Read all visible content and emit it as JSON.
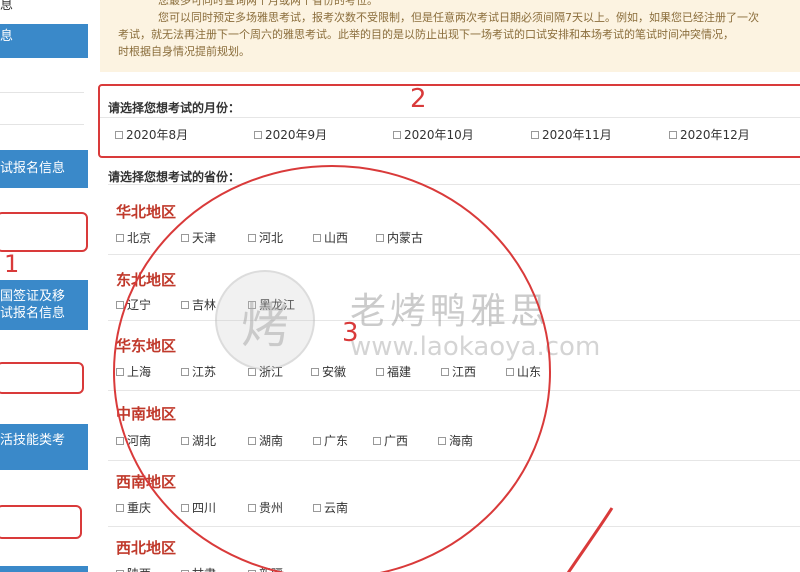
{
  "sidebar": {
    "top_label": "息",
    "item_1": "息",
    "item_2_line1": "试报名信息",
    "item_3_line1": "国签证及移",
    "item_3_line2": "试报名信息",
    "item_4_line1": "活技能类考"
  },
  "notice": {
    "line1": "您最多可同时查询两个月或两个省份的考位。",
    "line2": "您可以同时预定多场雅思考试，报考次数不受限制，但是任意两次考试日期必须间隔7天以上。例如，如果您已经注册了一次",
    "line3": "考试，就无法再注册下一个周六的雅思考试。此举的目的是以防止出现下一场考试的口试安排和本场考试的笔试时间冲突情况，",
    "line4": "时根据自身情况提前规划。"
  },
  "month_section": {
    "title": "请选择您想考试的月份：",
    "options": [
      "2020年8月",
      "2020年9月",
      "2020年10月",
      "2020年11月",
      "2020年12月"
    ]
  },
  "province_section": {
    "title": "请选择您想考试的省份：",
    "regions": [
      {
        "name": "华北地区",
        "provinces": [
          "北京",
          "天津",
          "河北",
          "山西",
          "内蒙古"
        ]
      },
      {
        "name": "东北地区",
        "provinces": [
          "辽宁",
          "吉林",
          "黑龙江"
        ]
      },
      {
        "name": "华东地区",
        "provinces": [
          "上海",
          "江苏",
          "浙江",
          "安徽",
          "福建",
          "江西",
          "山东"
        ]
      },
      {
        "name": "中南地区",
        "provinces": [
          "河南",
          "湖北",
          "湖南",
          "广东",
          "广西",
          "海南"
        ]
      },
      {
        "name": "西南地区",
        "provinces": [
          "重庆",
          "四川",
          "贵州",
          "云南"
        ]
      },
      {
        "name": "西北地区",
        "provinces": [
          "陕西",
          "甘肃",
          "新疆"
        ]
      }
    ]
  },
  "annotations": {
    "one": "1",
    "two": "2",
    "three": "3"
  },
  "watermark": {
    "logo_char": "烤",
    "brand": "老烤鸭雅思",
    "url": "www.laokaoya.com"
  },
  "colors": {
    "sidebar_button": "#3a89c9",
    "region_heading": "#c0392b",
    "annotation_red": "#d93a3a",
    "notice_bg": "#fcf3e1"
  }
}
